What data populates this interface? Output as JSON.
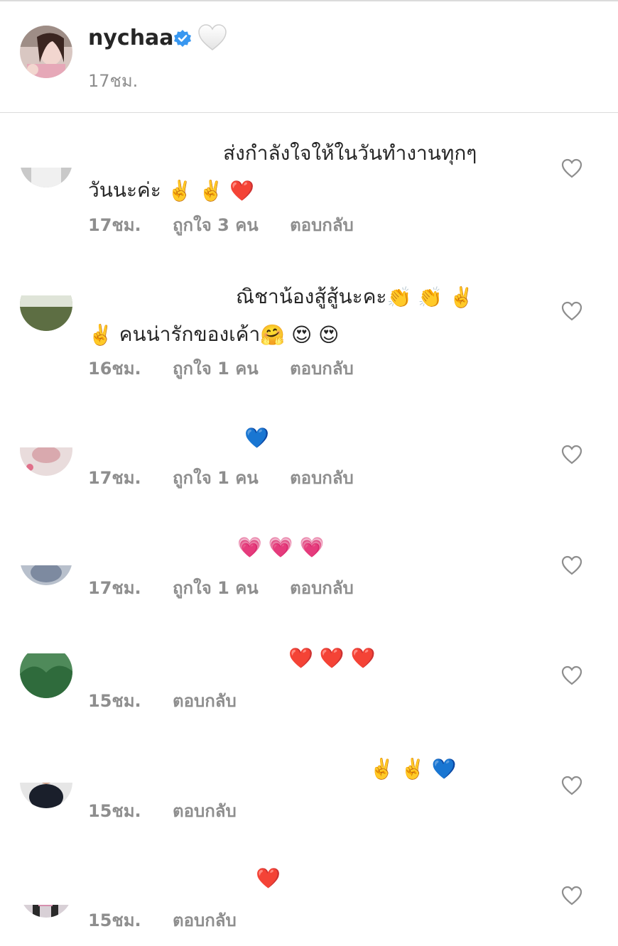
{
  "post": {
    "username": "nychaa",
    "time": "17ชม."
  },
  "comments": [
    {
      "text_line1": "ส่งกำลังใจให้ในวันทำงานทุกๆ",
      "text_line2": "วันนะค่ะ",
      "emojis": [
        "✌️",
        "✌️",
        "❤️"
      ],
      "time": "17ชม.",
      "likes": "ถูกใจ 3 คน",
      "reply": "ตอบกลับ"
    },
    {
      "text_line1": "ณิชาน้องสู้สู้นะคะ",
      "text_line2": "คนน่ารักของเค้า",
      "emojis_line1": [
        "👏",
        "👏",
        "✌️"
      ],
      "emojis_line2_prefix": "✌️",
      "emojis_line2": [
        "🤗",
        "😍",
        "😍"
      ],
      "time": "16ชม.",
      "likes": "ถูกใจ 1 คน",
      "reply": "ตอบกลับ"
    },
    {
      "emojis": [
        "💙"
      ],
      "time": "17ชม.",
      "likes": "ถูกใจ 1 คน",
      "reply": "ตอบกลับ"
    },
    {
      "emojis": [
        "💗",
        "💗",
        "💗"
      ],
      "time": "17ชม.",
      "likes": "ถูกใจ 1 คน",
      "reply": "ตอบกลับ"
    },
    {
      "emojis": [
        "❤️",
        "❤️",
        "❤️"
      ],
      "time": "15ชม.",
      "reply": "ตอบกลับ"
    },
    {
      "emojis": [
        "✌️",
        "✌️",
        "💙"
      ],
      "time": "15ชม.",
      "reply": "ตอบกลับ"
    },
    {
      "emojis": [
        "❤️"
      ],
      "time": "15ชม.",
      "reply": "ตอบกลับ"
    }
  ],
  "icons": {
    "verified": "verified-badge-icon",
    "white_heart": "white-heart-icon",
    "like": "heart-outline-icon"
  },
  "colors": {
    "verified_blue": "#3897f0",
    "muted_text": "#8e8e8e",
    "divider": "#dbdbdb"
  }
}
